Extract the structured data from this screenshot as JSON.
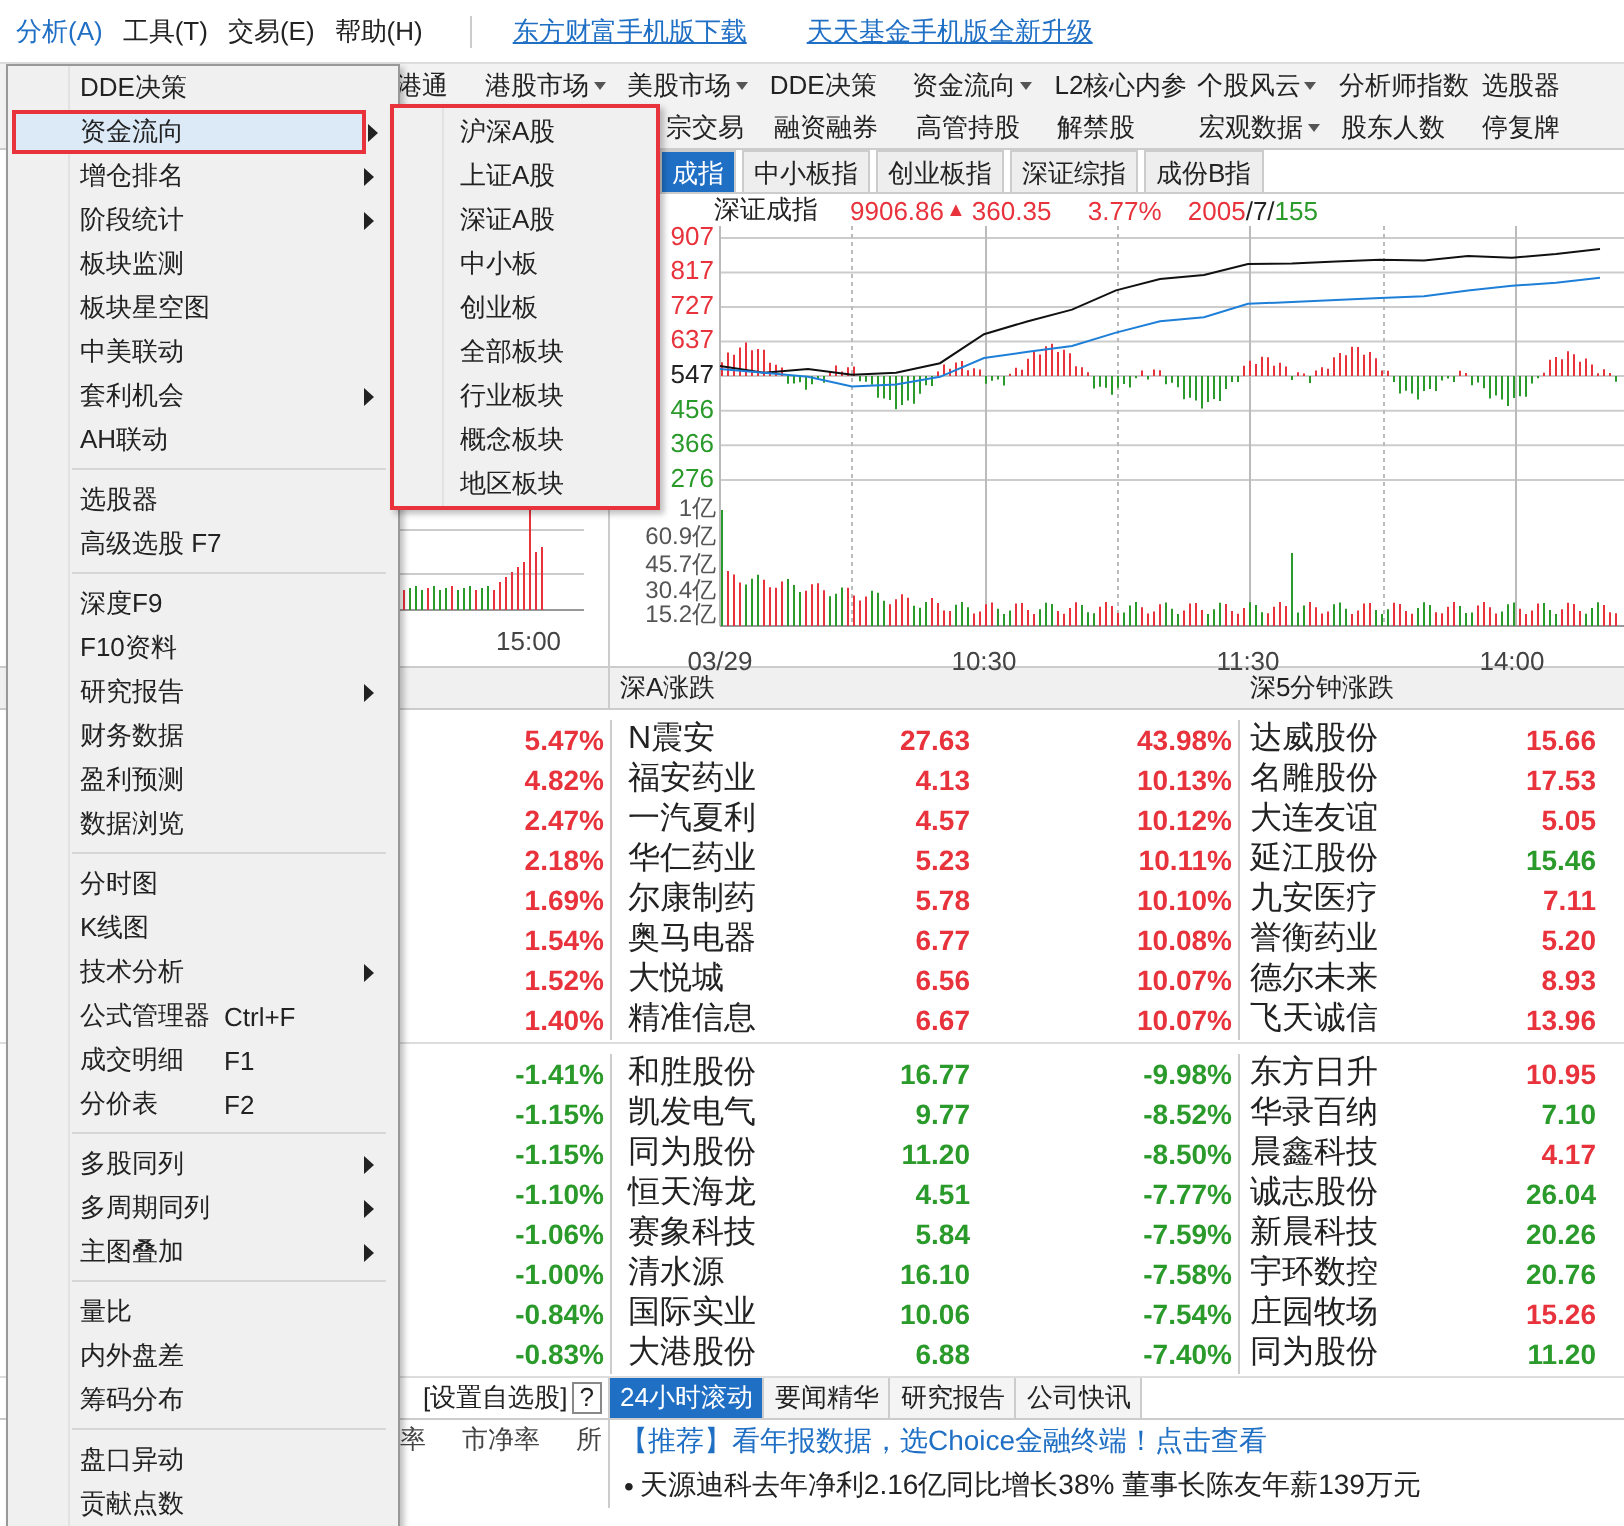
{
  "menubar": {
    "menus": [
      {
        "label": "分析(A)",
        "selected": true
      },
      {
        "label": "工具(T)",
        "selected": false
      },
      {
        "label": "交易(E)",
        "selected": false
      },
      {
        "label": "帮助(H)",
        "selected": false
      }
    ],
    "links": [
      "东方财富手机版下载",
      "天天基金手机版全新升级"
    ]
  },
  "toolbar": {
    "upper": [
      {
        "label": "港通",
        "dropdown": false
      },
      {
        "label": "港股市场",
        "dropdown": true
      },
      {
        "label": "美股市场",
        "dropdown": true
      },
      {
        "label": "DDE决策",
        "dropdown": false
      },
      {
        "label": "资金流向",
        "dropdown": true
      },
      {
        "label": "L2核心内参",
        "dropdown": false
      },
      {
        "label": "个股风云",
        "dropdown": true
      },
      {
        "label": "分析师指数",
        "dropdown": false
      },
      {
        "label": "选股器",
        "dropdown": false
      }
    ],
    "lower": [
      {
        "label": "宗交易",
        "dropdown": false
      },
      {
        "label": "融资融券",
        "dropdown": false
      },
      {
        "label": "高管持股",
        "dropdown": false
      },
      {
        "label": "解禁股",
        "dropdown": false
      },
      {
        "label": "宏观数据",
        "dropdown": true
      },
      {
        "label": "股东人数",
        "dropdown": false
      },
      {
        "label": "停复牌",
        "dropdown": false
      }
    ]
  },
  "chart": {
    "tabs": [
      {
        "label": "成指",
        "selected": true
      },
      {
        "label": "中小板指",
        "selected": false
      },
      {
        "label": "创业板指",
        "selected": false
      },
      {
        "label": "深证综指",
        "selected": false
      },
      {
        "label": "成份B指",
        "selected": false
      }
    ],
    "index_name": "深证成指",
    "value": "9906.86",
    "change_arrow": "▲",
    "change": "360.35",
    "change_pct": "3.77%",
    "up_count": "2005",
    "flat_count": "/7/",
    "down_count": "155",
    "volume_ticks": [
      "1亿",
      "60.9亿",
      "45.7亿",
      "30.4亿",
      "15.2亿"
    ],
    "mini_time_tick": "15:00",
    "chart_data": {
      "type": "line",
      "categories": [
        "03/29",
        null,
        null,
        null,
        null,
        null,
        "10:30",
        null,
        null,
        null,
        null,
        null,
        "11:30",
        null,
        null,
        null,
        null,
        null,
        "14:00",
        null,
        null
      ],
      "series": [
        {
          "color": "#111111",
          "values": [
            573,
            555,
            565,
            550,
            555,
            580,
            656,
            690,
            720,
            770,
            800,
            810,
            839,
            840,
            845,
            850,
            848,
            860,
            855,
            865,
            878
          ]
        },
        {
          "color": "#1e7fd8",
          "values": [
            565,
            555,
            545,
            520,
            525,
            545,
            594,
            610,
            625,
            660,
            690,
            700,
            735,
            740,
            745,
            750,
            755,
            770,
            782,
            790,
            803
          ]
        }
      ],
      "ylim": [
        -105,
        938
      ],
      "grid": true,
      "yticks": [
        {
          "value": 907,
          "label": "907"
        },
        {
          "value": 817,
          "label": "817"
        },
        {
          "value": 727,
          "label": "727"
        },
        {
          "value": 637,
          "label": "637"
        },
        {
          "value": 547,
          "label": "547"
        },
        {
          "value": 456,
          "label": "456"
        },
        {
          "value": 366,
          "label": "366"
        },
        {
          "value": 276,
          "label": "276"
        }
      ]
    },
    "price_tick_styles": [
      {
        "color": "#e8323c"
      },
      {
        "color": "#e8323c"
      },
      {
        "color": "#e8323c"
      },
      {
        "color": "#e8323c"
      },
      {
        "color": "#222222"
      },
      {
        "color": "#2a9a2a"
      },
      {
        "color": "#2a9a2a"
      },
      {
        "color": "#2a9a2a"
      }
    ]
  },
  "tables": {
    "middle_header": "深A涨跌",
    "right_header": "深5分钟涨跌",
    "groups": [
      [
        {
          "left": {
            "pct": "5.47%",
            "color": "#e8323c"
          },
          "name": "N震安",
          "price": "27.63",
          "pct": "43.98%",
          "color": "#e8323c",
          "right": {
            "name": "达威股份",
            "price": "15.66",
            "color": "#e8323c"
          }
        },
        {
          "left": {
            "pct": "4.82%",
            "color": "#e8323c"
          },
          "name": "福安药业",
          "price": "4.13",
          "pct": "10.13%",
          "color": "#e8323c",
          "right": {
            "name": "名雕股份",
            "price": "17.53",
            "color": "#e8323c"
          }
        },
        {
          "left": {
            "pct": "2.47%",
            "color": "#e8323c"
          },
          "name": "一汽夏利",
          "price": "4.57",
          "pct": "10.12%",
          "color": "#e8323c",
          "right": {
            "name": "大连友谊",
            "price": "5.05",
            "color": "#e8323c"
          }
        },
        {
          "left": {
            "pct": "2.18%",
            "color": "#e8323c"
          },
          "name": "华仁药业",
          "price": "5.23",
          "pct": "10.11%",
          "color": "#e8323c",
          "right": {
            "name": "延江股份",
            "price": "15.46",
            "color": "#2a9a2a"
          }
        },
        {
          "left": {
            "pct": "1.69%",
            "color": "#e8323c"
          },
          "name": "尔康制药",
          "price": "5.78",
          "pct": "10.10%",
          "color": "#e8323c",
          "right": {
            "name": "九安医疗",
            "price": "7.11",
            "color": "#e8323c"
          }
        },
        {
          "left": {
            "pct": "1.54%",
            "color": "#e8323c"
          },
          "name": "奥马电器",
          "price": "6.77",
          "pct": "10.08%",
          "color": "#e8323c",
          "right": {
            "name": "誉衡药业",
            "price": "5.20",
            "color": "#e8323c"
          }
        },
        {
          "left": {
            "pct": "1.52%",
            "color": "#e8323c"
          },
          "name": "大悦城",
          "price": "6.56",
          "pct": "10.07%",
          "color": "#e8323c",
          "right": {
            "name": "德尔未来",
            "price": "8.93",
            "color": "#e8323c"
          }
        },
        {
          "left": {
            "pct": "1.40%",
            "color": "#e8323c"
          },
          "name": "精准信息",
          "price": "6.67",
          "pct": "10.07%",
          "color": "#e8323c",
          "right": {
            "name": "飞天诚信",
            "price": "13.96",
            "color": "#e8323c"
          }
        }
      ],
      [
        {
          "left": {
            "pct": "-1.41%",
            "color": "#2a9a2a"
          },
          "name": "和胜股份",
          "price": "16.77",
          "pct": "-9.98%",
          "color": "#2a9a2a",
          "right": {
            "name": "东方日升",
            "price": "10.95",
            "color": "#e8323c"
          }
        },
        {
          "left": {
            "pct": "-1.15%",
            "color": "#2a9a2a"
          },
          "name": "凯发电气",
          "price": "9.77",
          "pct": "-8.52%",
          "color": "#2a9a2a",
          "right": {
            "name": "华录百纳",
            "price": "7.10",
            "color": "#2a9a2a"
          }
        },
        {
          "left": {
            "pct": "-1.15%",
            "color": "#2a9a2a"
          },
          "name": "同为股份",
          "price": "11.20",
          "pct": "-8.50%",
          "color": "#2a9a2a",
          "right": {
            "name": "晨鑫科技",
            "price": "4.17",
            "color": "#e8323c"
          }
        },
        {
          "left": {
            "pct": "-1.10%",
            "color": "#2a9a2a"
          },
          "name": "恒天海龙",
          "price": "4.51",
          "pct": "-7.77%",
          "color": "#2a9a2a",
          "right": {
            "name": "诚志股份",
            "price": "26.04",
            "color": "#2a9a2a"
          }
        },
        {
          "left": {
            "pct": "-1.06%",
            "color": "#2a9a2a"
          },
          "name": "赛象科技",
          "price": "5.84",
          "pct": "-7.59%",
          "color": "#2a9a2a",
          "right": {
            "name": "新晨科技",
            "price": "20.26",
            "color": "#2a9a2a"
          }
        },
        {
          "left": {
            "pct": "-1.00%",
            "color": "#2a9a2a"
          },
          "name": "清水源",
          "price": "16.10",
          "pct": "-7.58%",
          "color": "#2a9a2a",
          "right": {
            "name": "宇环数控",
            "price": "20.76",
            "color": "#2a9a2a"
          }
        },
        {
          "left": {
            "pct": "-0.84%",
            "color": "#2a9a2a"
          },
          "name": "国际实业",
          "price": "10.06",
          "pct": "-7.54%",
          "color": "#2a9a2a",
          "right": {
            "name": "庄园牧场",
            "price": "15.26",
            "color": "#e8323c"
          }
        },
        {
          "left": {
            "pct": "-0.83%",
            "color": "#2a9a2a"
          },
          "name": "大港股份",
          "price": "6.88",
          "pct": "-7.40%",
          "color": "#2a9a2a",
          "right": {
            "name": "同为股份",
            "price": "11.20",
            "color": "#2a9a2a"
          }
        }
      ]
    ]
  },
  "bottom": {
    "left_tab": "[设置自选股]",
    "help_button": "?",
    "left_columns": [
      "率",
      "市净率",
      "所"
    ],
    "news_tabs": [
      {
        "label": "24小时滚动",
        "selected": true
      },
      {
        "label": "要闻精华",
        "selected": false
      },
      {
        "label": "研究报告",
        "selected": false
      },
      {
        "label": "公司快讯",
        "selected": false
      }
    ],
    "promo": "【推荐】看年报数据，选Choice金融终端！点击查看",
    "bullet": "•",
    "news": "天源迪科去年净利2.16亿同比增长38% 董事长陈友年薪139万元"
  },
  "menu": {
    "groups": [
      [
        {
          "label": "DDE决策",
          "submenu": false,
          "selected": false
        },
        {
          "label": "资金流向",
          "submenu": true,
          "selected": true
        },
        {
          "label": "增仓排名",
          "submenu": true,
          "selected": false
        },
        {
          "label": "阶段统计",
          "submenu": true,
          "selected": false
        },
        {
          "label": "板块监测",
          "submenu": false,
          "selected": false
        },
        {
          "label": "板块星空图",
          "submenu": false,
          "selected": false
        },
        {
          "label": "中美联动",
          "submenu": false,
          "selected": false
        },
        {
          "label": "套利机会",
          "submenu": true,
          "selected": false
        },
        {
          "label": "AH联动",
          "submenu": false,
          "selected": false
        }
      ],
      [
        {
          "label": "选股器",
          "submenu": false,
          "selected": false
        },
        {
          "label": "高级选股 F7",
          "submenu": false,
          "selected": false
        }
      ],
      [
        {
          "label": "深度F9",
          "submenu": false,
          "selected": false
        },
        {
          "label": "F10资料",
          "submenu": false,
          "selected": false
        },
        {
          "label": "研究报告",
          "submenu": true,
          "selected": false
        },
        {
          "label": "财务数据",
          "submenu": false,
          "selected": false
        },
        {
          "label": "盈利预测",
          "submenu": false,
          "selected": false
        },
        {
          "label": "数据浏览",
          "submenu": false,
          "selected": false
        }
      ],
      [
        {
          "label": "分时图",
          "submenu": false,
          "selected": false
        },
        {
          "label": "K线图",
          "submenu": false,
          "selected": false
        },
        {
          "label": "技术分析",
          "submenu": true,
          "selected": false
        },
        {
          "label": "公式管理器",
          "shortcut": "Ctrl+F",
          "submenu": false,
          "selected": false
        },
        {
          "label": "成交明细",
          "shortcut": "F1",
          "submenu": false,
          "selected": false
        },
        {
          "label": "分价表",
          "shortcut": "F2",
          "submenu": false,
          "selected": false
        }
      ],
      [
        {
          "label": "多股同列",
          "submenu": true,
          "selected": false
        },
        {
          "label": "多周期同列",
          "submenu": true,
          "selected": false
        },
        {
          "label": "主图叠加",
          "submenu": true,
          "selected": false
        }
      ],
      [
        {
          "label": "量比",
          "submenu": false,
          "selected": false
        },
        {
          "label": "内外盘差",
          "submenu": false,
          "selected": false
        },
        {
          "label": "筹码分布",
          "submenu": false,
          "selected": false
        }
      ],
      [
        {
          "label": "盘口异动",
          "submenu": false,
          "selected": false
        },
        {
          "label": "贡献点数",
          "submenu": false,
          "selected": false
        }
      ]
    ],
    "submenu": [
      "沪深A股",
      "上证A股",
      "深证A股",
      "中小板",
      "创业板",
      "全部板块",
      "行业板块",
      "概念板块",
      "地区板块"
    ]
  }
}
